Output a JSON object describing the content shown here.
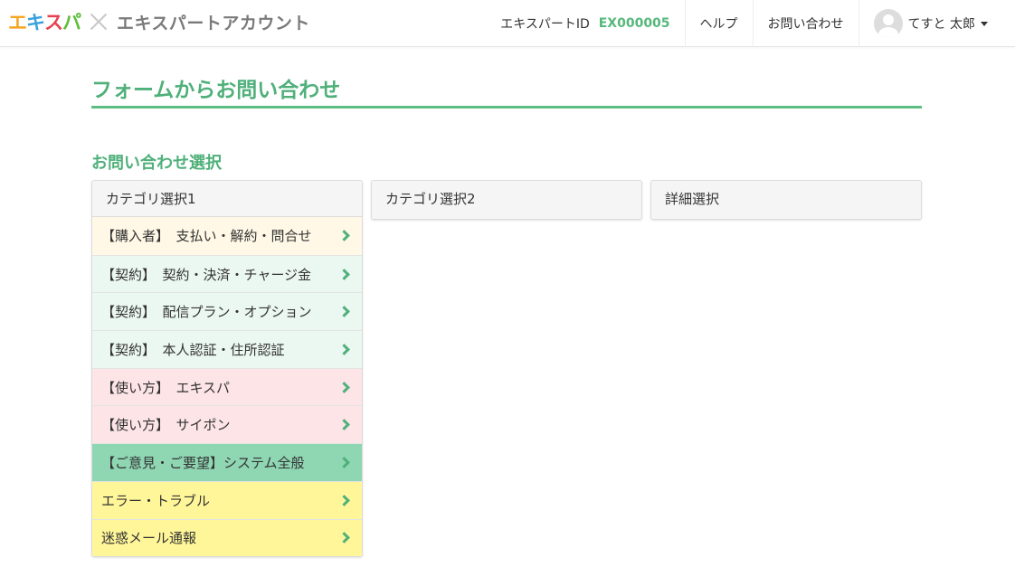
{
  "header": {
    "logo": {
      "chars": [
        "エ",
        "キ",
        "ス",
        "パ"
      ],
      "colors": [
        "#f5a623",
        "#3aa0de",
        "#e8414f",
        "#5cbf3a"
      ]
    },
    "app_name": "エキスパートアカウント",
    "expert_id_label": "エキスパートID",
    "expert_id_value": "EX000005",
    "help": "ヘルプ",
    "contact": "お問い合わせ",
    "user_name": "てすと 太郎"
  },
  "page": {
    "title": "フォームからお問い合わせ",
    "section_title": "お問い合わせ選択"
  },
  "panels": {
    "category1": {
      "header": "カテゴリ選択1",
      "items": [
        {
          "label": "【購入者】　支払い・解約・問合せ",
          "bg": "#fff8e6"
        },
        {
          "label": "【契約】　契約・決済・チャージ金",
          "bg": "#ebf7f1"
        },
        {
          "label": "【契約】　配信プラン・オプション",
          "bg": "#ebf7f1"
        },
        {
          "label": "【契約】　本人認証・住所認証",
          "bg": "#ebf7f1"
        },
        {
          "label": "【使い方】　エキスパ",
          "bg": "#fde4e7"
        },
        {
          "label": "【使い方】　サイポン",
          "bg": "#fde4e7"
        },
        {
          "label": "【ご意見・ご要望】システム全般",
          "bg": "#8fd6b3"
        },
        {
          "label": "エラー・トラブル",
          "bg": "#fff699"
        },
        {
          "label": "迷惑メール通報",
          "bg": "#fff699"
        }
      ]
    },
    "category2": {
      "header": "カテゴリ選択2"
    },
    "detail": {
      "header": "詳細選択"
    }
  },
  "colors": {
    "accent": "#4fb07a",
    "id_value": "#55b87b"
  }
}
